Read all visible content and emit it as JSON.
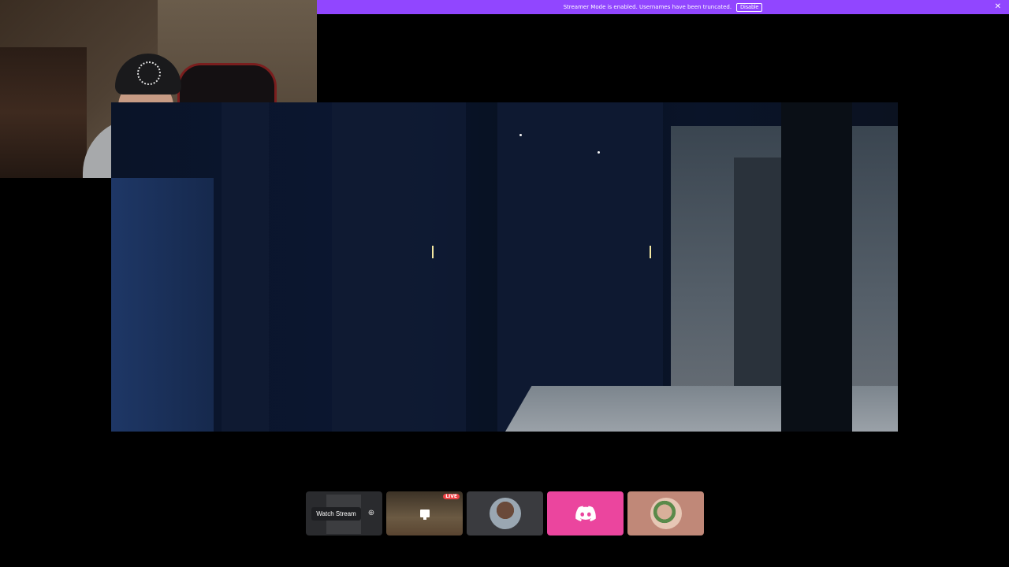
{
  "banner": {
    "message": "Streamer Mode is enabled. Usernames have been truncated.",
    "disable_label": "Disable",
    "close_glyph": "✕",
    "color": "#9146ff"
  },
  "tiles": {
    "watch_stream_label": "Watch Stream",
    "zoom_icon": "⊕",
    "live_badge": "LIVE",
    "discord_color": "#eb459e"
  }
}
